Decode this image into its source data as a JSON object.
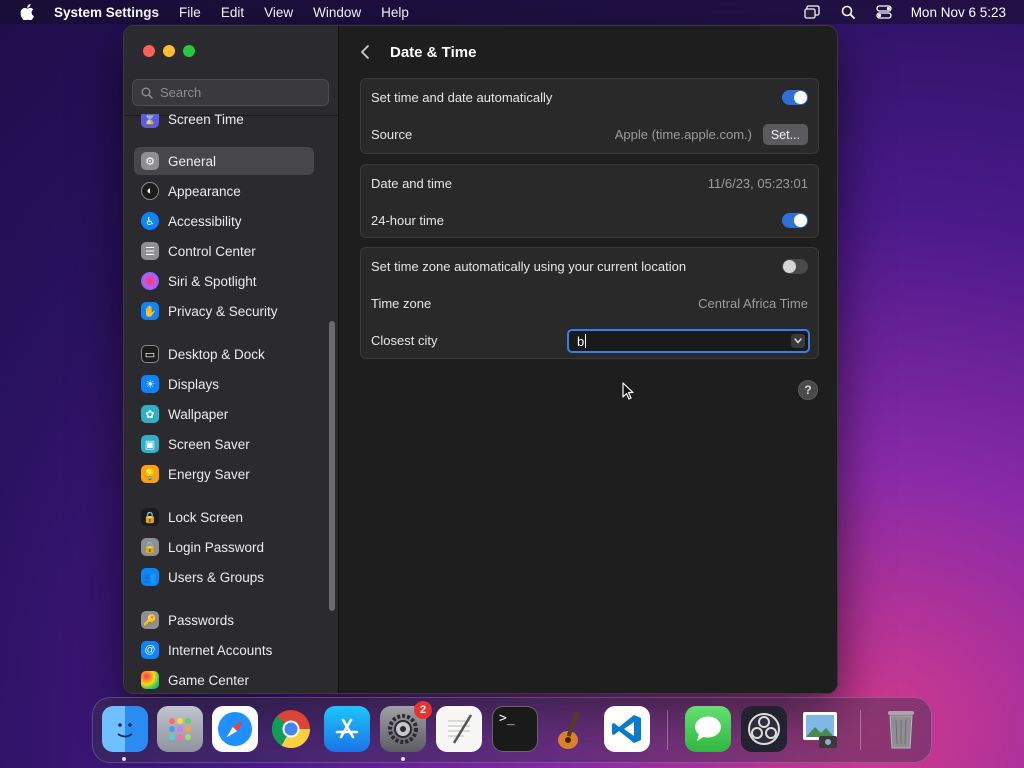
{
  "menubar": {
    "app_name": "System Settings",
    "items": [
      "File",
      "Edit",
      "View",
      "Window",
      "Help"
    ],
    "clock": "Mon Nov 6  5:23"
  },
  "sidebar": {
    "search_placeholder": "Search",
    "items": [
      {
        "label": "Screen Time",
        "icon": "hourglass-icon",
        "color": "#5e5ce6"
      },
      {
        "label": "General",
        "icon": "gear-icon",
        "color": "#8e8e93"
      },
      {
        "label": "Appearance",
        "icon": "appearance-icon",
        "color": "#1c1c1e"
      },
      {
        "label": "Accessibility",
        "icon": "accessibility-icon",
        "color": "#0a84ff"
      },
      {
        "label": "Control Center",
        "icon": "control-center-icon",
        "color": "#8e8e93"
      },
      {
        "label": "Siri & Spotlight",
        "icon": "siri-icon",
        "color": "#bf5af2"
      },
      {
        "label": "Privacy & Security",
        "icon": "hand-icon",
        "color": "#0a84ff"
      },
      {
        "label": "Desktop & Dock",
        "icon": "dock-icon",
        "color": "#1c1c1e"
      },
      {
        "label": "Displays",
        "icon": "sun-icon",
        "color": "#0a84ff"
      },
      {
        "label": "Wallpaper",
        "icon": "flower-icon",
        "color": "#30b0c7"
      },
      {
        "label": "Screen Saver",
        "icon": "screen-saver-icon",
        "color": "#30b0c7"
      },
      {
        "label": "Energy Saver",
        "icon": "bulb-icon",
        "color": "#ff9f0a"
      },
      {
        "label": "Lock Screen",
        "icon": "lock-icon",
        "color": "#1c1c1e"
      },
      {
        "label": "Login Password",
        "icon": "lock-icon",
        "color": "#8e8e93"
      },
      {
        "label": "Users & Groups",
        "icon": "users-icon",
        "color": "#0a84ff"
      },
      {
        "label": "Passwords",
        "icon": "key-icon",
        "color": "#8e8e93"
      },
      {
        "label": "Internet Accounts",
        "icon": "at-icon",
        "color": "#0a84ff"
      },
      {
        "label": "Game Center",
        "icon": "game-center-icon",
        "color": "#f2f2f7"
      }
    ]
  },
  "main": {
    "title": "Date & Time",
    "set_auto_label": "Set time and date automatically",
    "set_auto_on": true,
    "source_label": "Source",
    "source_value": "Apple (time.apple.com.)",
    "set_button": "Set...",
    "date_time_label": "Date and time",
    "date_time_value": "11/6/23, 05:23:01",
    "hour24_label": "24-hour time",
    "hour24_on": true,
    "tz_auto_label": "Set time zone automatically using your current location",
    "tz_auto_on": false,
    "tz_label": "Time zone",
    "tz_value": "Central Africa Time",
    "city_label": "Closest city",
    "city_value": "b",
    "help": "?"
  },
  "dock": {
    "apps": [
      "finder-icon",
      "launchpad-icon",
      "safari-icon",
      "chrome-icon",
      "app-store-icon",
      "system-settings-icon",
      "textedit-icon",
      "terminal-icon",
      "garageband-icon",
      "vscode-icon",
      "messages-icon",
      "obs-icon",
      "preview-icon",
      "trash-icon"
    ],
    "settings_badge": "2"
  }
}
